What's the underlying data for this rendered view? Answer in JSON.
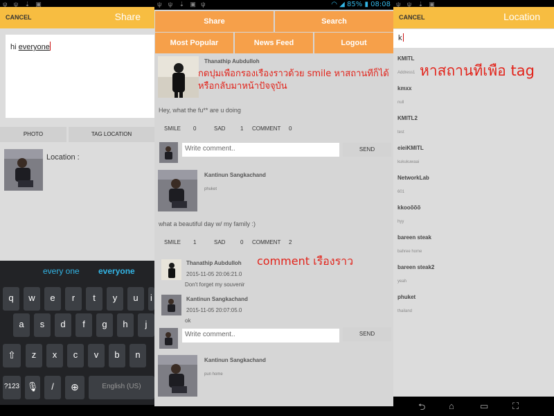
{
  "panel1": {
    "header": {
      "cancel": "CANCEL",
      "title": "Share"
    },
    "compose": {
      "text_before": "hi ",
      "text_word": "everyone"
    },
    "buttons": {
      "photo": "PHOTO",
      "tag_location": "TAG LOCATION"
    },
    "location_label": "Location :",
    "keyboard": {
      "suggestions": [
        "every one",
        "everyone"
      ],
      "row1": [
        "q",
        "w",
        "e",
        "r",
        "t",
        "y",
        "u",
        "i"
      ],
      "row2": [
        "a",
        "s",
        "d",
        "f",
        "g",
        "h",
        "j"
      ],
      "row3": [
        "z",
        "x",
        "c",
        "v",
        "b",
        "n"
      ],
      "sym": "?123",
      "slash": "/",
      "space": "English (US)"
    }
  },
  "panel2": {
    "status": {
      "battery": "85%",
      "time": "08:08"
    },
    "menu": {
      "share": "Share",
      "search": "Search",
      "most_popular": "Most Popular",
      "news_feed": "News Feed",
      "logout": "Logout"
    },
    "post1": {
      "author": "Thanathip Aubdulloh",
      "annotation": "กดปุมเพือกรองเรืองราวด้วย smile หาสถานทีก็ได้ หรือกลับมาหน้าปัจจุบัน",
      "text": "Hey, what the fu** are u doing",
      "smile_label": "SMILE",
      "smile_count": "0",
      "sad_label": "SAD",
      "sad_count": "1",
      "comment_label": "COMMENT",
      "comment_count": "0"
    },
    "comment_placeholder": "Write comment..",
    "send": "SEND",
    "post2": {
      "author": "Kantinun Sangkachand",
      "place": "phuket",
      "text": "what a beautiful day w/ my family :)",
      "smile_label": "SMILE",
      "smile_count": "1",
      "sad_label": "SAD",
      "sad_count": "0",
      "comment_label": "COMMENT",
      "comment_count": "2"
    },
    "comments_annotation": "comment เรืองราว",
    "comments": [
      {
        "author": "Thanathip Aubdulloh",
        "time": "2015-11-05 20:06:21.0",
        "text": "Don't forget my souvenir"
      },
      {
        "author": "Kantinun Sangkachand",
        "time": "2015-11-05 20:07:05.0",
        "text": "ok"
      }
    ],
    "post3": {
      "author": "Kantinun Sangkachand",
      "place": "pun home"
    }
  },
  "panel3": {
    "header": {
      "cancel": "CANCEL",
      "title": "Location"
    },
    "search_value": "k",
    "annotation": "หาสถานทีเพือ tag",
    "locations": [
      {
        "name": "KMITL",
        "sub": "Address1"
      },
      {
        "name": "kmxx",
        "sub": "null"
      },
      {
        "name": "KMITL2",
        "sub": "test"
      },
      {
        "name": "eieiKMITL",
        "sub": "kukukuwaai"
      },
      {
        "name": "NetworkLab",
        "sub": "601"
      },
      {
        "name": "kkooõõõ",
        "sub": "hyy"
      },
      {
        "name": "bareen steak",
        "sub": "bahree home"
      },
      {
        "name": "bareen steak2",
        "sub": "yeah"
      },
      {
        "name": "phuket",
        "sub": "thailand"
      }
    ]
  },
  "colors": {
    "header_yellow": "#f7bd41",
    "menu_orange": "#f6a04a",
    "annotation_red": "#e2231a",
    "keyboard_blue": "#33b5e5"
  }
}
